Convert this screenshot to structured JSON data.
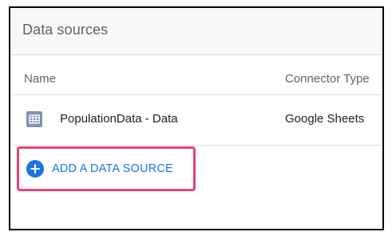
{
  "panel": {
    "title": "Data sources"
  },
  "columns": {
    "name": "Name",
    "connector_type": "Connector Type"
  },
  "rows": [
    {
      "icon": "sheets-table-icon",
      "name": "PopulationData - Data",
      "connector_type": "Google Sheets"
    }
  ],
  "actions": {
    "add_data_source": {
      "icon": "add-circle-icon",
      "label": "ADD A DATA SOURCE"
    }
  },
  "colors": {
    "accent": "#1a73e8",
    "highlight_border": "#e8446f",
    "header_bg": "#f8f9fa",
    "sheet_icon": "#7f93b5"
  }
}
